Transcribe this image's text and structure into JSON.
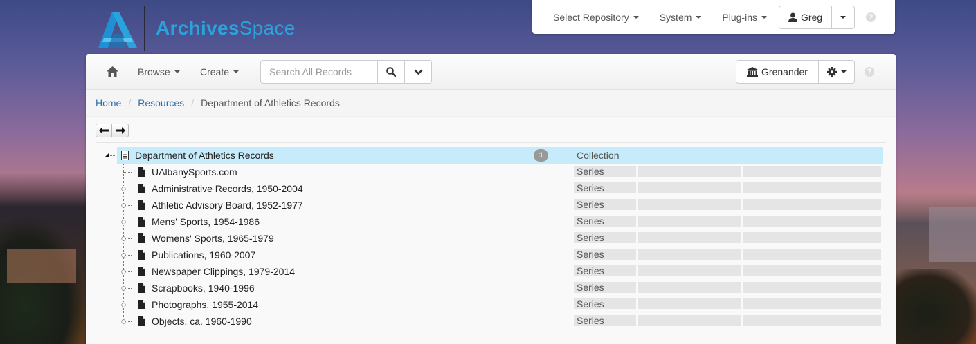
{
  "app": {
    "name_bold": "Archives",
    "name_light": "Space"
  },
  "topbar": {
    "select_repository": "Select Repository",
    "system": "System",
    "plugins": "Plug-ins",
    "user": "Greg",
    "help": "?"
  },
  "toolbar": {
    "browse": "Browse",
    "create": "Create",
    "search_placeholder": "Search All Records",
    "repository": "Grenander",
    "help": "?"
  },
  "breadcrumb": {
    "home": "Home",
    "resources": "Resources",
    "current": "Department of Athletics Records"
  },
  "tree": {
    "root": {
      "title": "Department of Athletics Records",
      "badge": "1",
      "level": "Collection"
    },
    "children": [
      {
        "title": "UAlbanySports.com",
        "level": "Series"
      },
      {
        "title": "Administrative Records, 1950-2004",
        "level": "Series"
      },
      {
        "title": "Athletic Advisory Board, 1952-1977",
        "level": "Series"
      },
      {
        "title": "Mens' Sports, 1954-1986",
        "level": "Series"
      },
      {
        "title": "Womens' Sports, 1965-1979",
        "level": "Series"
      },
      {
        "title": "Publications, 1960-2007",
        "level": "Series"
      },
      {
        "title": "Newspaper Clippings, 1979-2014",
        "level": "Series"
      },
      {
        "title": "Scrapbooks, 1940-1996",
        "level": "Series"
      },
      {
        "title": "Photographs, 1955-2014",
        "level": "Series"
      },
      {
        "title": "Objects, ca. 1960-1990",
        "level": "Series"
      }
    ]
  },
  "colors": {
    "brand": "#2aa3dc",
    "link": "#2a6fb0",
    "selected_row": "#c6ebfb"
  }
}
